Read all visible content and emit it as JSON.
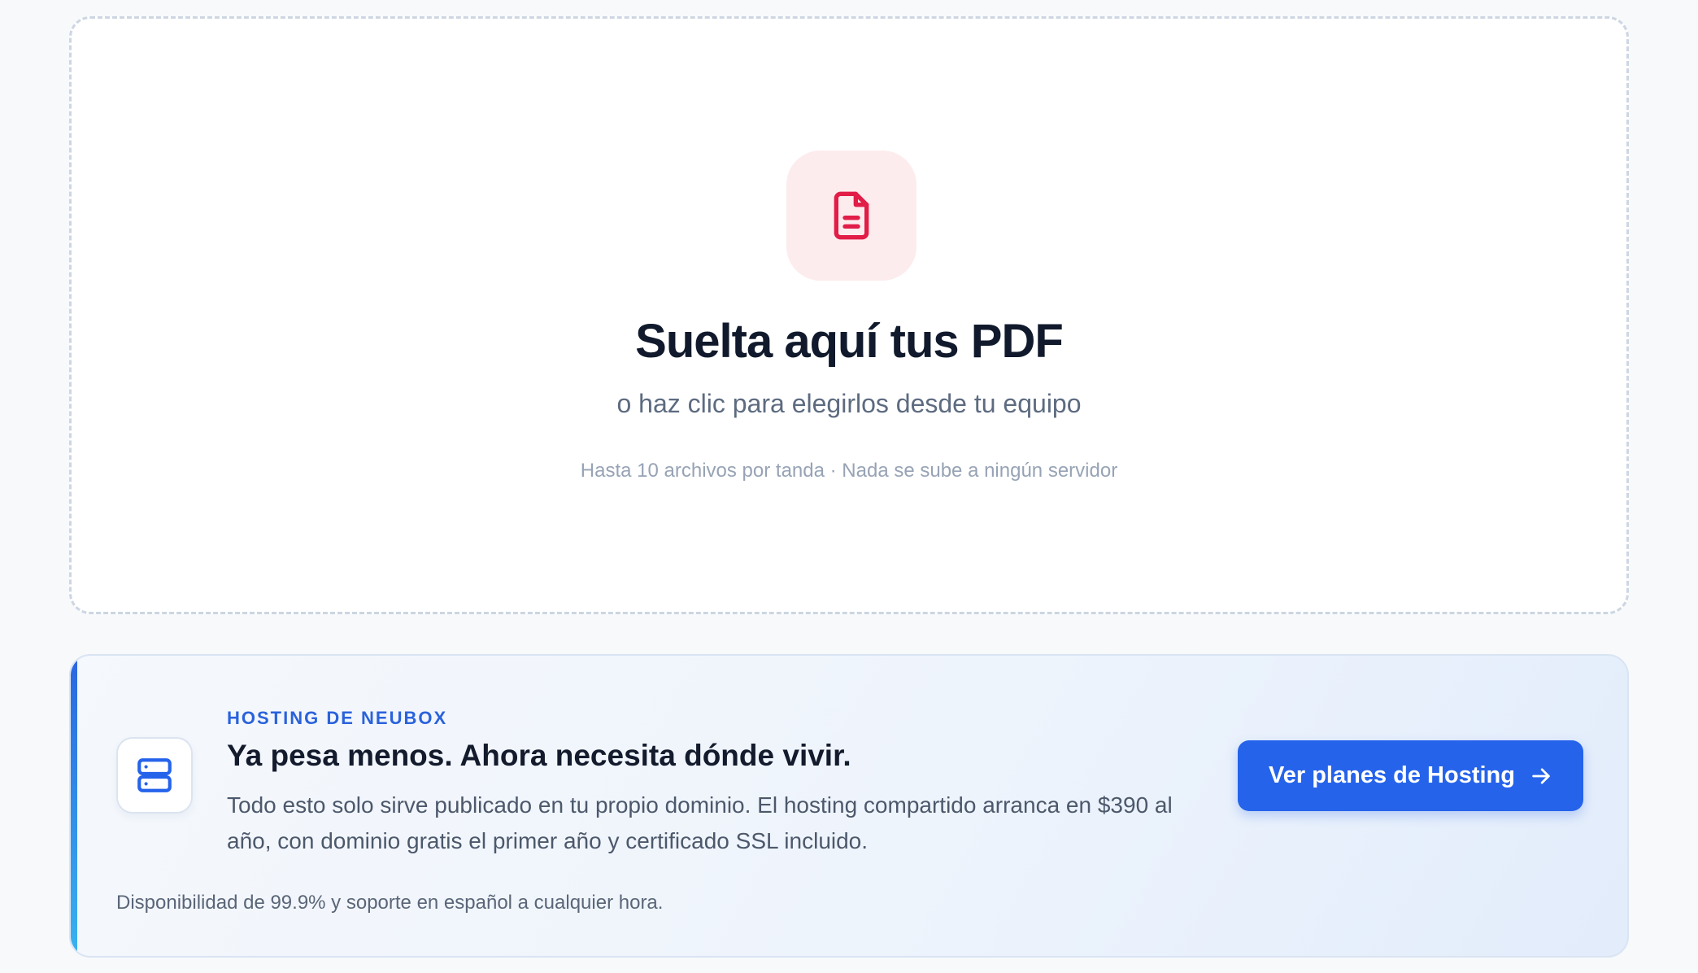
{
  "dropzone": {
    "icon": "file-text-icon",
    "title": "Suelta aquí tus PDF",
    "subtitle": "o haz clic para elegirlos desde tu equipo",
    "note": "Hasta 10 archivos por tanda · Nada se sube a ningún servidor",
    "colors": {
      "icon_bg": "#fdecee",
      "icon": "#e11d48",
      "border": "#cdd6e2"
    }
  },
  "promo": {
    "icon": "server-icon",
    "eyebrow": "HOSTING DE NEUBOX",
    "headline": "Ya pesa menos. Ahora necesita dónde vivir.",
    "body": "Todo esto solo sirve publicado en tu propio dominio. El hosting compartido arranca en $390 al año, con dominio gratis el primer año y certificado SSL incluido.",
    "cta_label": "Ver planes de Hosting",
    "cta_icon": "arrow-right-icon",
    "footnote": "Disponibilidad de 99.9% y soporte en español a cualquier hora.",
    "colors": {
      "accent": "#2563eb",
      "eyebrow": "#2a62db"
    }
  }
}
